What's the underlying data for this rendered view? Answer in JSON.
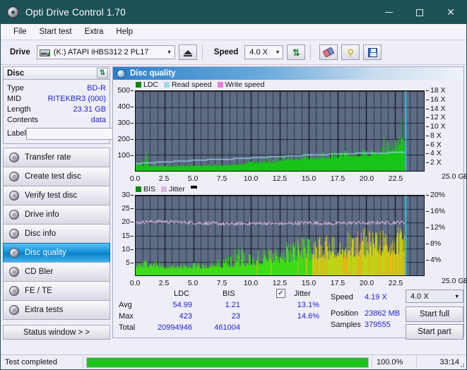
{
  "window": {
    "title": "Opti Drive Control 1.70",
    "icon": "disc-icon",
    "minimize": "—",
    "maximize": "□",
    "close": "✕"
  },
  "menu": [
    "File",
    "Start test",
    "Extra",
    "Help"
  ],
  "toolbar": {
    "drive_label": "Drive",
    "drive_value": "(K:)  ATAPI iHBS312   2 PL17",
    "eject_title": "Eject",
    "speed_label": "Speed",
    "speed_value": "4.0 X",
    "refresh_title": "Refresh",
    "erase_title": "Erase",
    "keys_title": "Keys",
    "save_title": "Save"
  },
  "disc_panel": {
    "header": "Disc",
    "refresh_icon": "refresh-icon",
    "rows": [
      {
        "key": "Type",
        "value": "BD-R"
      },
      {
        "key": "MID",
        "value": "RITEKBR3 (000)"
      },
      {
        "key": "Length",
        "value": "23.31 GB"
      },
      {
        "key": "Contents",
        "value": "data"
      }
    ],
    "label_key": "Label",
    "label_value": "",
    "label_button_icon": "cd-icon"
  },
  "sidebar": {
    "items": [
      {
        "label": "Transfer rate",
        "active": false
      },
      {
        "label": "Create test disc",
        "active": false
      },
      {
        "label": "Verify test disc",
        "active": false
      },
      {
        "label": "Drive info",
        "active": false
      },
      {
        "label": "Disc info",
        "active": false
      },
      {
        "label": "Disc quality",
        "active": true
      },
      {
        "label": "CD Bler",
        "active": false
      },
      {
        "label": "FE / TE",
        "active": false
      },
      {
        "label": "Extra tests",
        "active": false
      }
    ],
    "status_window_button": "Status window > >"
  },
  "main": {
    "title": "Disc quality",
    "icon": "disc-quality-icon"
  },
  "stats": {
    "col_ldc": "LDC",
    "col_bis": "BIS",
    "row_avg": "Avg",
    "row_max": "Max",
    "row_total": "Total",
    "avg_ldc": "54.99",
    "avg_bis": "1.21",
    "max_ldc": "423",
    "max_bis": "23",
    "total_ldc": "20994946",
    "total_bis": "461004",
    "jitter_label": "Jitter",
    "jitter_checked": "✓",
    "jitter_avg": "13.1%",
    "jitter_max": "14.6%",
    "speed_label": "Speed",
    "speed_value": "4.19 X",
    "speed_select": "4.0 X",
    "position_label": "Position",
    "position_value": "23862 MB",
    "samples_label": "Samples",
    "samples_value": "379555",
    "start_full": "Start full",
    "start_part": "Start part"
  },
  "statusbar": {
    "message": "Test completed",
    "percent_text": "100.0%",
    "percent": 100,
    "elapsed": "33:14"
  },
  "colors": {
    "ldc": "#17c417",
    "bis": "#17c417",
    "read_speed": "#9fd8f2",
    "write_speed": "#f07ae0",
    "jitter": "#d9b6e0",
    "plot_bg": "#5d6b85",
    "accent": "#1d5158",
    "value_text": "#2222cc",
    "progress": "#1ec41e"
  },
  "chart_data": [
    {
      "type": "bar",
      "name": "quality-top",
      "title": "",
      "xlabel": "GB",
      "ylabel": "",
      "legend": [
        {
          "label": "LDC",
          "color": "#0a8a0a"
        },
        {
          "label": "Read speed",
          "color": "#9fd8f2"
        },
        {
          "label": "Write speed",
          "color": "#f07ae0"
        }
      ],
      "legend_position": "top-left",
      "x": [
        0.0,
        2.5,
        5.0,
        7.5,
        10.0,
        12.5,
        15.0,
        17.5,
        20.0,
        22.5,
        25.0
      ],
      "xlim": [
        0,
        25.0
      ],
      "xtick_labels": [
        "0.0",
        "2.5",
        "5.0",
        "7.5",
        "10.0",
        "12.5",
        "15.0",
        "17.5",
        "20.0",
        "22.5",
        "25.0 GB"
      ],
      "ylim": [
        0,
        500
      ],
      "ytick_labels": [
        "100",
        "200",
        "300",
        "400",
        "500"
      ],
      "yticks": [
        100,
        200,
        300,
        400,
        500
      ],
      "y2lim": [
        0,
        18
      ],
      "y2tick_labels": [
        "2 X",
        "4 X",
        "6 X",
        "8 X",
        "10 X",
        "12 X",
        "14 X",
        "16 X",
        "18 X"
      ],
      "y2ticks": [
        2,
        4,
        6,
        8,
        10,
        12,
        14,
        16,
        18
      ],
      "grid": true,
      "series": [
        {
          "name": "LDC",
          "color": "#17c417",
          "kind": "bars",
          "note": "error counts per sample along the disc",
          "envelope_x": [
            0.0,
            0.4,
            0.9,
            1.0,
            1.1,
            1.5,
            3.0,
            5.0,
            7.0,
            9.0,
            10.0,
            11.0,
            11.5,
            12.0,
            12.5,
            13.5,
            15.0,
            16.5,
            18.0,
            19.5,
            21.0,
            22.0,
            22.6,
            22.9,
            23.2,
            23.4
          ],
          "envelope_y": [
            80,
            45,
            285,
            260,
            40,
            38,
            36,
            38,
            42,
            50,
            70,
            66,
            120,
            74,
            95,
            100,
            108,
            120,
            128,
            140,
            150,
            300,
            180,
            423,
            250,
            160
          ],
          "baseline_y": [
            38,
            30,
            32,
            30,
            28,
            28,
            28,
            30,
            32,
            36,
            48,
            46,
            50,
            50,
            62,
            66,
            72,
            78,
            84,
            90,
            98,
            110,
            120,
            150,
            160,
            120
          ]
        },
        {
          "name": "Read speed",
          "color": "#9fd8f2",
          "kind": "line",
          "unit": "X",
          "x": [
            0.0,
            1.0,
            2.5,
            4.0,
            5.5,
            7.0,
            8.5,
            10.0,
            11.5,
            13.0,
            14.5,
            16.0,
            17.5,
            19.0,
            20.5,
            22.0,
            23.3
          ],
          "y": [
            1.6,
            1.8,
            2.0,
            2.2,
            2.4,
            2.6,
            2.7,
            2.9,
            3.1,
            3.3,
            3.5,
            3.6,
            3.8,
            3.9,
            4.0,
            4.1,
            4.19
          ]
        },
        {
          "name": "Write speed",
          "color": "#f07ae0",
          "kind": "line",
          "x": [],
          "y": []
        }
      ],
      "marker_line": {
        "x": 23.4,
        "color": "#2fe0ff",
        "label": "current position"
      }
    },
    {
      "type": "bar",
      "name": "quality-bottom",
      "title": "",
      "xlabel": "GB",
      "ylabel": "",
      "legend": [
        {
          "label": "BIS",
          "color": "#0a8a0a"
        },
        {
          "label": "Jitter",
          "color": "#d9b6e0"
        }
      ],
      "legend_position": "top-left",
      "xlim": [
        0,
        25.0
      ],
      "xtick_labels": [
        "0.0",
        "2.5",
        "5.0",
        "7.5",
        "10.0",
        "12.5",
        "15.0",
        "17.5",
        "20.0",
        "22.5",
        "25.0 GB"
      ],
      "ylim": [
        0,
        30
      ],
      "ytick_labels": [
        "5",
        "10",
        "15",
        "20",
        "25",
        "30"
      ],
      "yticks": [
        5,
        10,
        15,
        20,
        25,
        30
      ],
      "y2lim": [
        0,
        20
      ],
      "y2tick_labels": [
        "4%",
        "8%",
        "12%",
        "16%",
        "20%"
      ],
      "y2ticks": [
        4,
        8,
        12,
        16,
        20
      ],
      "grid": true,
      "series": [
        {
          "name": "BIS",
          "color": "#17c417",
          "kind": "bars",
          "note": "burst indicator subcode errors; bars turn yellow/orange at higher radius",
          "envelope_x": [
            0.0,
            0.5,
            1.2,
            2.0,
            3.0,
            4.0,
            5.0,
            6.0,
            7.0,
            8.0,
            9.0,
            9.5,
            10.0,
            11.0,
            12.0,
            13.0,
            14.0,
            15.0,
            16.0,
            17.0,
            18.0,
            19.0,
            20.0,
            21.0,
            22.0,
            22.8,
            23.3
          ],
          "envelope_y": [
            4.5,
            5,
            8,
            5,
            4.5,
            4.5,
            5,
            4.5,
            6,
            7,
            12,
            8,
            9,
            10,
            11,
            13,
            15,
            14,
            16,
            15,
            17,
            16,
            18,
            17,
            19,
            20,
            23
          ],
          "baseline_y": [
            2.5,
            2.6,
            2.8,
            2.6,
            2.5,
            2.5,
            2.6,
            2.6,
            2.8,
            3.0,
            3.4,
            3.3,
            3.6,
            4.0,
            4.4,
            4.8,
            5.2,
            5.4,
            5.8,
            6.0,
            6.4,
            6.6,
            7.0,
            7.2,
            7.6,
            8.0,
            9.0
          ]
        },
        {
          "name": "Jitter",
          "color": "#d9b6e0",
          "kind": "line",
          "unit": "%",
          "x": [
            0.0,
            1.0,
            2.0,
            3.0,
            4.0,
            5.0,
            6.0,
            7.0,
            8.0,
            9.0,
            10.0,
            11.0,
            12.0,
            13.0,
            14.0,
            15.0,
            16.0,
            17.0,
            18.0,
            19.0,
            20.0,
            21.0,
            22.0,
            23.0,
            23.4
          ],
          "y": [
            13.2,
            13.4,
            13.5,
            13.4,
            13.3,
            13.2,
            13.1,
            13.0,
            12.9,
            13.0,
            13.0,
            13.1,
            13.0,
            13.0,
            13.1,
            13.2,
            13.1,
            13.0,
            13.1,
            13.2,
            13.1,
            13.2,
            13.2,
            13.3,
            13.3
          ]
        }
      ],
      "marker_line": {
        "x": 23.4,
        "color": "#2fe0ff",
        "label": "current position"
      }
    }
  ]
}
